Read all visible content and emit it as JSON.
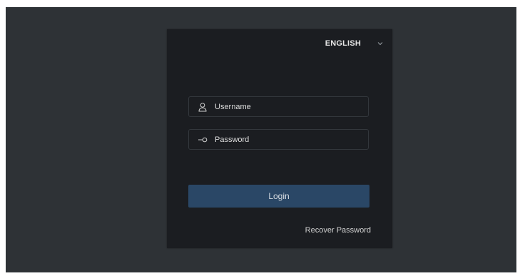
{
  "language": {
    "selected": "ENGLISH",
    "icon": "chevron-down-icon"
  },
  "form": {
    "username": {
      "placeholder": "Username",
      "value": "",
      "icon": "user-icon"
    },
    "password": {
      "placeholder": "Password",
      "value": "",
      "icon": "key-icon"
    },
    "login_label": "Login",
    "recover_label": "Recover Password"
  },
  "colors": {
    "background": "#2e3236",
    "panel": "#1b1d21",
    "login_button": "#2a4766"
  }
}
